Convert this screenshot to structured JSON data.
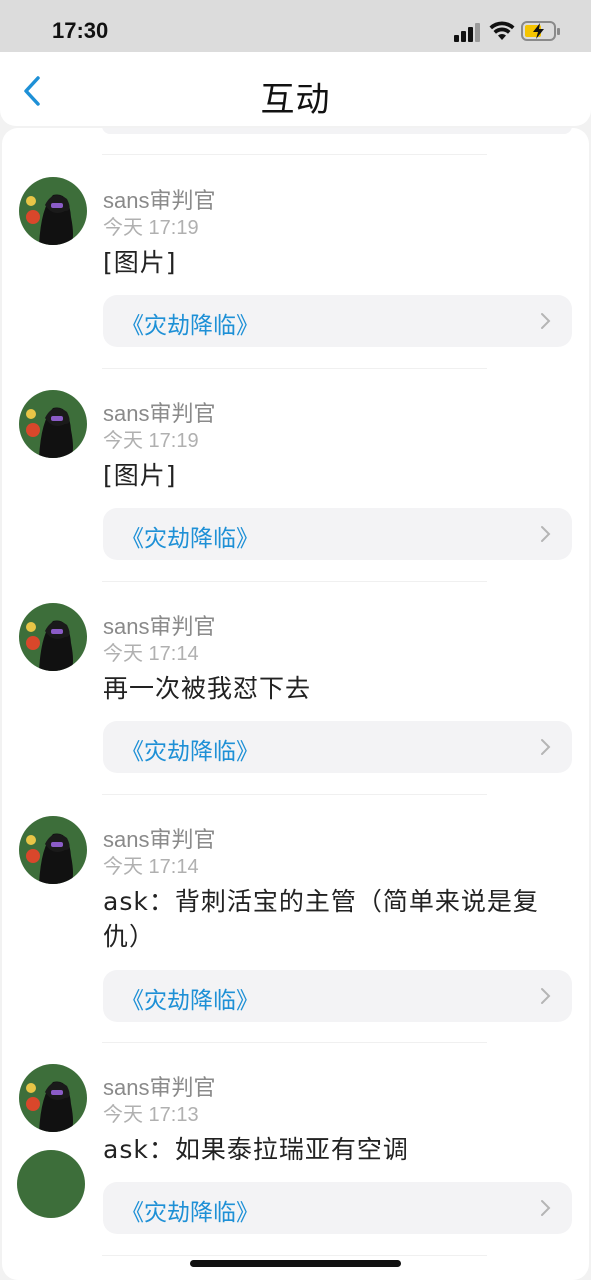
{
  "status_bar": {
    "time": "17:30"
  },
  "header": {
    "title": "互动"
  },
  "colors": {
    "link": "#1e90d6",
    "background": "#f2f2f2"
  },
  "icons": [
    "back-arrow",
    "signal-bars",
    "wifi",
    "battery-charging",
    "chevron-right"
  ],
  "feed": {
    "items": [
      {
        "username": "sans审判官",
        "time": "今天 17:19",
        "content": "[图片]",
        "source": "《灾劫降临》"
      },
      {
        "username": "sans审判官",
        "time": "今天 17:19",
        "content": "[图片]",
        "source": "《灾劫降临》"
      },
      {
        "username": "sans审判官",
        "time": "今天 17:14",
        "content": "再一次被我怼下去",
        "source": "《灾劫降临》"
      },
      {
        "username": "sans审判官",
        "time": "今天 17:14",
        "content": "ask：背刺活宝的主管（简单来说是复仇）",
        "source": "《灾劫降临》"
      },
      {
        "username": "sans审判官",
        "time": "今天 17:13",
        "content": "ask：如果泰拉瑞亚有空调",
        "source": "《灾劫降临》"
      }
    ]
  }
}
